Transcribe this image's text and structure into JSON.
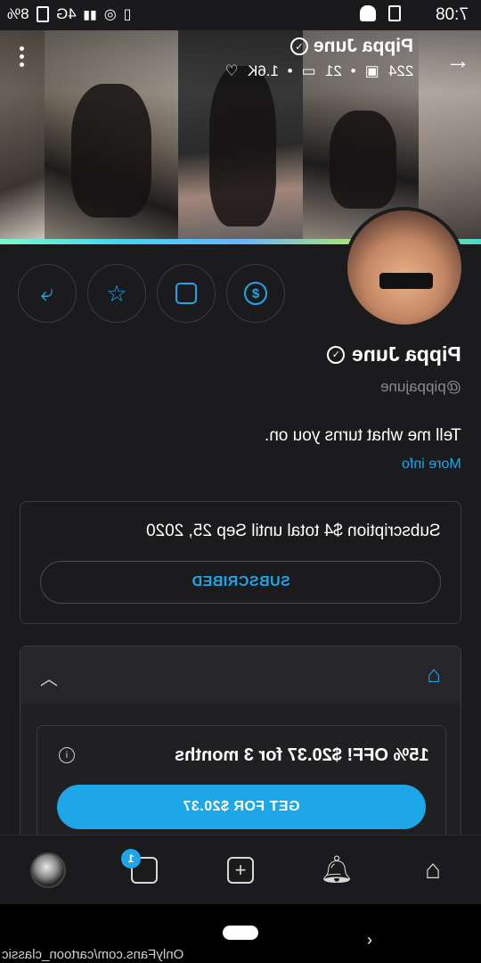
{
  "status_bar": {
    "time": "7:08",
    "battery": "8%",
    "network": "4G"
  },
  "cover": {
    "name": "Pippa June",
    "photos": "224",
    "videos": "21",
    "likes": "1.6K"
  },
  "profile": {
    "name": "Pippa June",
    "handle": "@pippajune",
    "bio": "Tell me what turns you on.",
    "more_info": "More info"
  },
  "subscription": {
    "text": "Subscription $4 total until Sep 25, 2020",
    "button": "SUBSCRIBED"
  },
  "promo": {
    "text": "15% OFF!  $20.37 for 3 months",
    "button": "GET FOR $20.37"
  },
  "bottom_nav": {
    "messages_badge": "1"
  },
  "footer": {
    "watermark": "OnlyFans.com/cartoon_classic"
  },
  "colors": {
    "accent": "#1ea7e8",
    "background": "#1b1b1d"
  }
}
